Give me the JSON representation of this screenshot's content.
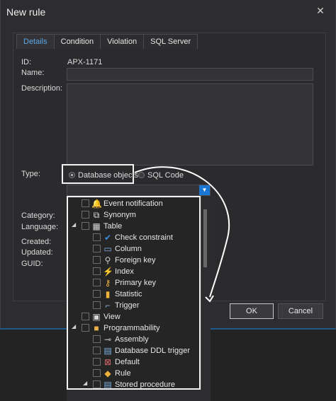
{
  "window": {
    "title": "New rule",
    "close_glyph": "✕"
  },
  "tabs": [
    {
      "label": "Details",
      "active": true
    },
    {
      "label": "Condition",
      "active": false
    },
    {
      "label": "Violation",
      "active": false
    },
    {
      "label": "SQL Server",
      "active": false
    }
  ],
  "fields": {
    "id_label": "ID:",
    "id_value": "APX-1171",
    "name_label": "Name:",
    "name_value": "",
    "description_label": "Description:",
    "description_value": "",
    "type_label": "Type:",
    "category_label": "Category:",
    "language_label": "Language:",
    "created_label": "Created:",
    "updated_label": "Updated:",
    "guid_label": "GUID:"
  },
  "type_options": [
    {
      "label": "Database objects",
      "selected": true
    },
    {
      "label": "SQL Code",
      "selected": false
    }
  ],
  "combo": {
    "value": "",
    "arrow_glyph": "▼"
  },
  "tree": [
    {
      "label": "Event notification",
      "level": 1,
      "expander": "",
      "icon": "bell-icon",
      "glyph": "🔔",
      "color": "#f0b33a"
    },
    {
      "label": "Synonym",
      "level": 1,
      "expander": "",
      "icon": "synonym-icon",
      "glyph": "⧉",
      "color": "#e0e0e0"
    },
    {
      "label": "Table",
      "level": 1,
      "expander": "◢",
      "icon": "table-icon",
      "glyph": "▦",
      "color": "#d8d8d8"
    },
    {
      "label": "Check constraint",
      "level": 2,
      "expander": "",
      "icon": "check-icon",
      "glyph": "✔",
      "color": "#3a8ee6"
    },
    {
      "label": "Column",
      "level": 2,
      "expander": "",
      "icon": "column-icon",
      "glyph": "▭",
      "color": "#7fb2e5"
    },
    {
      "label": "Foreign key",
      "level": 2,
      "expander": "",
      "icon": "foreign-key-icon",
      "glyph": "⚲",
      "color": "#c9c9c9"
    },
    {
      "label": "Index",
      "level": 2,
      "expander": "",
      "icon": "index-icon",
      "glyph": "⚡",
      "color": "#f0b33a"
    },
    {
      "label": "Primary key",
      "level": 2,
      "expander": "",
      "icon": "primary-key-icon",
      "glyph": "⚷",
      "color": "#f0b33a"
    },
    {
      "label": "Statistic",
      "level": 2,
      "expander": "",
      "icon": "statistic-icon",
      "glyph": "▮",
      "color": "#f0b33a"
    },
    {
      "label": "Trigger",
      "level": 2,
      "expander": "",
      "icon": "trigger-icon",
      "glyph": "⌐",
      "color": "#7fb2e5"
    },
    {
      "label": "View",
      "level": 1,
      "expander": "",
      "icon": "view-icon",
      "glyph": "▣",
      "color": "#d8d8d8"
    },
    {
      "label": "Programmability",
      "level": 1,
      "expander": "◢",
      "icon": "folder-icon",
      "glyph": "■",
      "color": "#e8b04a"
    },
    {
      "label": "Assembly",
      "level": 2,
      "expander": "",
      "icon": "assembly-icon",
      "glyph": "⊸",
      "color": "#c9c9c9"
    },
    {
      "label": "Database DDL trigger",
      "level": 2,
      "expander": "",
      "icon": "ddl-trigger-icon",
      "glyph": "▤",
      "color": "#7fb2e5"
    },
    {
      "label": "Default",
      "level": 2,
      "expander": "",
      "icon": "default-icon",
      "glyph": "⊠",
      "color": "#d06a6a"
    },
    {
      "label": "Rule",
      "level": 2,
      "expander": "",
      "icon": "rule-icon",
      "glyph": "◆",
      "color": "#f0b33a"
    },
    {
      "label": "Stored procedure",
      "level": 2,
      "expander": "◢",
      "icon": "stored-procedure-icon",
      "glyph": "▤",
      "color": "#7fb2e5"
    }
  ],
  "buttons": {
    "ok": "OK",
    "cancel": "Cancel"
  },
  "colors": {
    "accent": "#1976d2",
    "active_tab": "#5aa7e6",
    "highlight_border": "#f2f2f2"
  }
}
